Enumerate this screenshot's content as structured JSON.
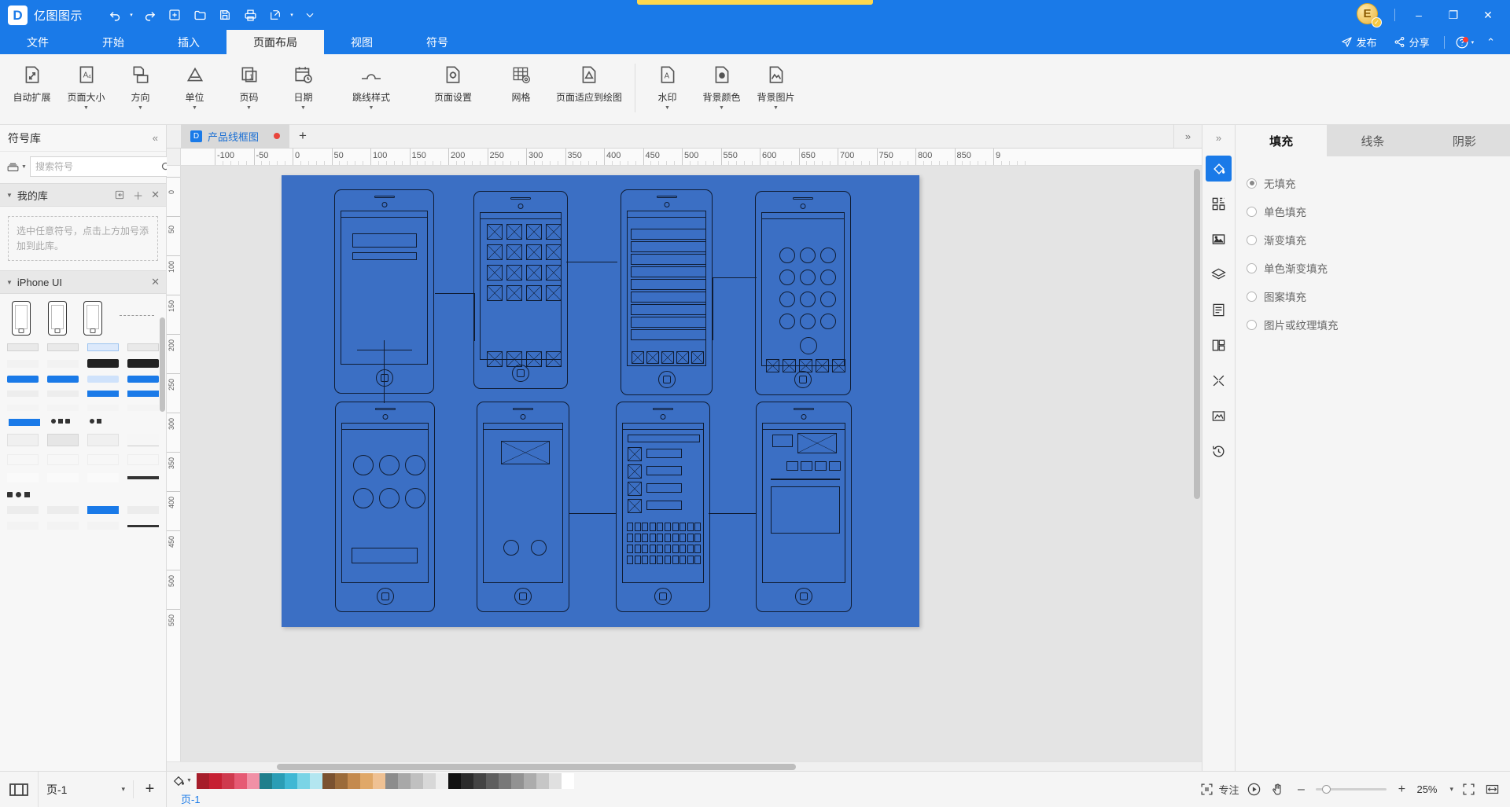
{
  "app": {
    "brand_initial": "D",
    "brand_name": "亿图图示"
  },
  "quick_access": [
    {
      "name": "undo",
      "glyph": "↶",
      "caret": true
    },
    {
      "name": "redo",
      "glyph": "↷",
      "caret": false
    },
    {
      "name": "new",
      "glyph": "⊞",
      "caret": false
    },
    {
      "name": "open",
      "glyph": "🗁",
      "caret": false
    },
    {
      "name": "save",
      "glyph": "🖫",
      "caret": false
    },
    {
      "name": "print",
      "glyph": "⎙",
      "caret": false
    },
    {
      "name": "export",
      "glyph": "⇱",
      "caret": true
    },
    {
      "name": "customize",
      "glyph": "⌄",
      "caret": false
    }
  ],
  "titlebar": {
    "avatar_letter": "E",
    "minimize": "–",
    "maximize": "❐",
    "close": "✕"
  },
  "menu": {
    "items": [
      {
        "label": "文件",
        "active": false
      },
      {
        "label": "开始",
        "active": false
      },
      {
        "label": "插入",
        "active": false
      },
      {
        "label": "页面布局",
        "active": true
      },
      {
        "label": "视图",
        "active": false
      },
      {
        "label": "符号",
        "active": false
      }
    ],
    "publish_label": "发布",
    "share_label": "分享",
    "collapse_glyph": "⌃"
  },
  "ribbon": {
    "buttons": [
      {
        "label": "自动扩展",
        "icon": "auto-expand-icon",
        "caret": false
      },
      {
        "label": "页面大小",
        "icon": "page-size-icon",
        "caret": true
      },
      {
        "label": "方向",
        "icon": "orientation-icon",
        "caret": true
      },
      {
        "label": "单位",
        "icon": "unit-icon",
        "caret": true
      },
      {
        "label": "页码",
        "icon": "page-number-icon",
        "caret": true
      },
      {
        "label": "日期",
        "icon": "date-icon",
        "caret": true
      },
      {
        "label": "跳线样式",
        "icon": "jump-line-icon",
        "caret": true
      },
      {
        "label": "页面设置",
        "icon": "page-setup-icon",
        "caret": false
      },
      {
        "label": "网格",
        "icon": "grid-icon",
        "caret": false
      },
      {
        "label": "页面适应到绘图",
        "icon": "fit-page-icon",
        "caret": false
      },
      {
        "label": "水印",
        "icon": "watermark-icon",
        "caret": true
      },
      {
        "label": "背景颜色",
        "icon": "background-color-icon",
        "caret": true
      },
      {
        "label": "背景图片",
        "icon": "background-image-icon",
        "caret": true
      }
    ]
  },
  "left_panel": {
    "title": "符号库",
    "collapse_glyph": "«",
    "search": {
      "placeholder": "搜索符号",
      "value": "",
      "icon": "search-icon"
    },
    "sections": [
      {
        "name": "我的库",
        "empty_hint": "选中任意符号，点击上方加号添加到此库。",
        "expanded": true
      },
      {
        "name": "iPhone UI",
        "expanded": true
      }
    ]
  },
  "document": {
    "tab_label": "产品线框图",
    "modified": true,
    "add_tab_glyph": "+"
  },
  "rulers": {
    "horizontal_labels": [
      "-100",
      "-50",
      "0",
      "50",
      "100",
      "150",
      "200",
      "250",
      "300",
      "350",
      "400",
      "450",
      "500",
      "550",
      "600",
      "650",
      "700",
      "750",
      "800",
      "850",
      "9"
    ],
    "vertical_labels": [
      "0",
      "50",
      "100",
      "150",
      "200",
      "250",
      "300",
      "350",
      "400",
      "450",
      "500",
      "550"
    ]
  },
  "canvas": {
    "page_fill": "#3b6fc4"
  },
  "icon_strip": {
    "collapse_glyph": "»",
    "buttons": [
      {
        "name": "fill-icon",
        "active": true
      },
      {
        "name": "shapes-icon",
        "active": false
      },
      {
        "name": "image-icon",
        "active": false
      },
      {
        "name": "layers-icon",
        "active": false
      },
      {
        "name": "page-icon",
        "active": false
      },
      {
        "name": "chart-icon",
        "active": false
      },
      {
        "name": "crop-icon",
        "active": false
      },
      {
        "name": "frame-icon",
        "active": false
      },
      {
        "name": "history-icon",
        "active": false
      }
    ]
  },
  "right_panel": {
    "tabs": [
      {
        "label": "填充",
        "active": true
      },
      {
        "label": "线条",
        "active": false
      },
      {
        "label": "阴影",
        "active": false
      }
    ],
    "fill_options": [
      {
        "label": "无填充",
        "selected": true
      },
      {
        "label": "单色填充",
        "selected": false
      },
      {
        "label": "渐变填充",
        "selected": false
      },
      {
        "label": "单色渐变填充",
        "selected": false
      },
      {
        "label": "图案填充",
        "selected": false
      },
      {
        "label": "图片或纹理填充",
        "selected": false
      }
    ]
  },
  "status_bar": {
    "page_selector": "页-1",
    "page_selector_caret": "▾",
    "add_page_glyph": "+",
    "page_tab": "页-1",
    "focus_label": "专注",
    "zoom_value": "25%",
    "zoom_caret": "▾",
    "zoom_out": "–",
    "zoom_in": "+",
    "swatch_colors": [
      "#a61d2a",
      "#c62033",
      "#cf3a4e",
      "#e65a74",
      "#f190a6",
      "#1f7f8c",
      "#2a9db5",
      "#3fb8d4",
      "#7ad4e6",
      "#b3e6f0",
      "#7a5230",
      "#9b6b3a",
      "#c48a4e",
      "#e0a868",
      "#efc193",
      "#8c8c8c",
      "#a8a8a8",
      "#c0c0c0",
      "#d8d8d8",
      "#eeeeee",
      "#111111",
      "#2b2b2b",
      "#444444",
      "#5e5e5e",
      "#787878",
      "#929292",
      "#acacac",
      "#c6c6c6",
      "#e0e0e0",
      "#ffffff"
    ],
    "palette_tool_icon": "fill-bucket-icon"
  }
}
